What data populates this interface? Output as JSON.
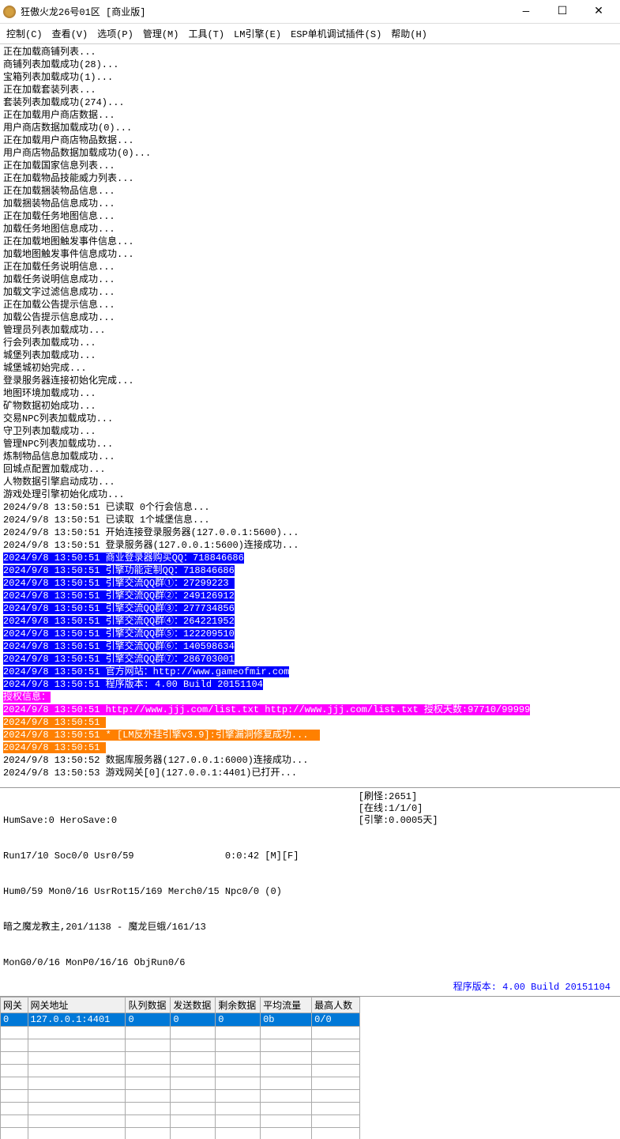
{
  "window": {
    "title": "狂傲火龙26号01区 [商业版]",
    "min": "—",
    "max": "☐",
    "close": "✕"
  },
  "menu": {
    "control": "控制(C)",
    "view": "查看(V)",
    "options": "选项(P)",
    "manage": "管理(M)",
    "tools": "工具(T)",
    "lm": "LM引擎(E)",
    "esp": "ESP单机调试插件(S)",
    "help": "帮助(H)"
  },
  "log": {
    "plain1": [
      "正在加载商铺列表...",
      "商铺列表加载成功(28)...",
      "宝箱列表加载成功(1)...",
      "正在加载套装列表...",
      "套装列表加载成功(274)...",
      "正在加载用户商店数据...",
      "用户商店数据加载成功(0)...",
      "正在加载用户商店物品数据...",
      "用户商店物品数据加载成功(0)...",
      "正在加载国家信息列表...",
      "正在加载物品技能威力列表...",
      "正在加载捆装物品信息...",
      "加载捆装物品信息成功...",
      "正在加载任务地图信息...",
      "加载任务地图信息成功...",
      "正在加载地图触发事件信息...",
      "加载地图触发事件信息成功...",
      "正在加载任务说明信息...",
      "加载任务说明信息成功...",
      "加载文字过滤信息成功...",
      "正在加载公告提示信息...",
      "加载公告提示信息成功...",
      "管理员列表加载成功...",
      "行会列表加载成功...",
      "城堡列表加载成功...",
      "城堡城初始完成...",
      "登录服务器连接初始化完成...",
      "地图环境加载成功...",
      "矿物数据初始成功...",
      "交易NPC列表加载成功...",
      "守卫列表加载成功...",
      "管理NPC列表加载成功...",
      "炼制物品信息加载成功...",
      "回城点配置加载成功...",
      "人物数据引擎启动成功...",
      "游戏处理引擎初始化成功...",
      "2024/9/8 13:50:51 已读取 0个行会信息...",
      "2024/9/8 13:50:51 已读取 1个城堡信息...",
      "2024/9/8 13:50:51 开始连接登录服务器(127.0.0.1:5600)...",
      "2024/9/8 13:50:51 登录服务器(127.0.0.1:5600)连接成功..."
    ],
    "blue": [
      "2024/9/8 13:50:51 商业登录器购买QQ：718846686",
      "2024/9/8 13:50:51 引擎功能定制QQ：718846686",
      "2024/9/8 13:50:51 引擎交流QQ群①：27299223 ",
      "2024/9/8 13:50:51 引擎交流QQ群②：249126912",
      "2024/9/8 13:50:51 引擎交流QQ群③：277734856",
      "2024/9/8 13:50:51 引擎交流QQ群④：264221952",
      "2024/9/8 13:50:51 引擎交流QQ群⑤：122209510",
      "2024/9/8 13:50:51 引擎交流QQ群⑥：140598634",
      "2024/9/8 13:50:51 引擎交流QQ群⑦：286703001",
      "2024/9/8 13:50:51 官方网站：http://www.gameofmir.com",
      "2024/9/8 13:50:51 程序版本: 4.00 Build 20151104"
    ],
    "magenta": [
      "授权信息：",
      "2024/9/8 13:50:51 http://www.jjj.com/list.txt http://www.jjj.com/list.txt 授权天数:97710/99999"
    ],
    "orange": [
      "2024/9/8 13:50:51 ",
      "2024/9/8 13:50:51 * [LM反外挂引擎v3.9]:引擎漏洞修复成功...  ",
      "2024/9/8 13:50:51 "
    ],
    "plain2": [
      "2024/9/8 13:50:52 数据库服务器(127.0.0.1:6000)连接成功...",
      "2024/9/8 13:50:53 游戏网关[0](127.0.0.1:4401)已打开..."
    ]
  },
  "stats": {
    "l1": "HumSave:0 HeroSave:0",
    "l2": "Run17/10 Soc0/0 Usr0/59                0:0:42 [M][F]",
    "l3": "Hum0/59 Mon0/16 UsrRot15/169 Merch0/15 Npc0/0 (0)",
    "l4": "暗之魔龙教主,201/1138 - 魔龙巨蛾/161/13",
    "l5": "MonG0/0/16 MonP0/16/16 ObjRun0/6",
    "m1": "[刷怪:2651]",
    "m2": "[在线:1/1/0]",
    "m3": "[引擎:0.0005天]",
    "version": "程序版本: 4.00 Build 20151104"
  },
  "grid": {
    "headers": {
      "gw": "网关",
      "addr": "网关地址",
      "queue": "队列数据",
      "send": "发送数据",
      "remain": "剩余数据",
      "flow": "平均流量",
      "max": "最高人数"
    },
    "row": {
      "gw": "0",
      "addr": "127.0.0.1:4401",
      "queue": "0",
      "send": "0",
      "remain": "0",
      "flow": "0b",
      "max": "0/0"
    }
  }
}
